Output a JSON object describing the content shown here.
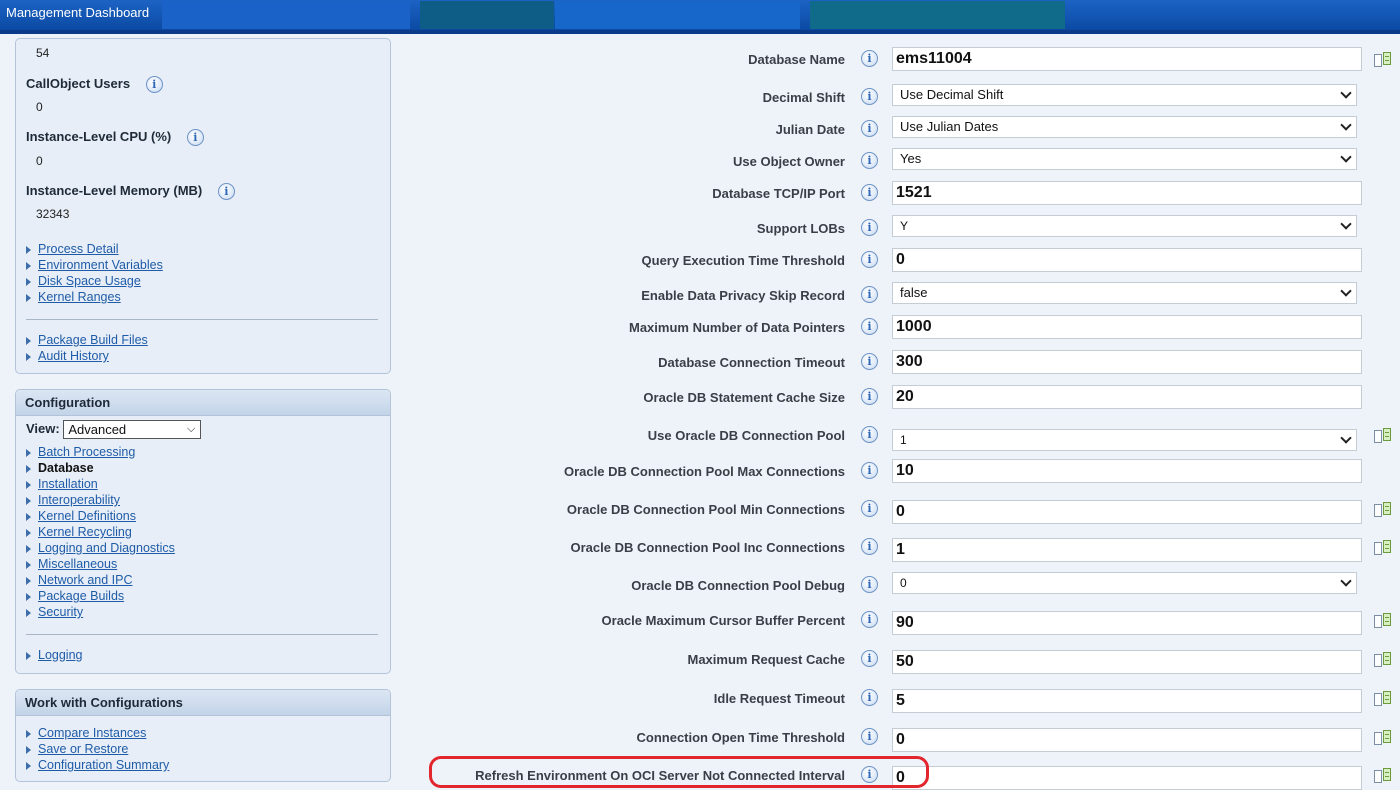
{
  "app": {
    "title": "Management Dashboard"
  },
  "sidebar": {
    "stats": [
      {
        "label": "",
        "value": "54"
      },
      {
        "label": "CallObject Users",
        "value": "0"
      },
      {
        "label": "Instance-Level CPU (%)",
        "value": "0"
      },
      {
        "label": "Instance-Level Memory (MB)",
        "value": "32343"
      }
    ],
    "links_group1": [
      "Process Detail",
      "Environment Variables",
      "Disk Space Usage",
      "Kernel Ranges"
    ],
    "links_group2": [
      "Package Build Files",
      "Audit History"
    ],
    "configuration": {
      "header": "Configuration",
      "view_label": "View:",
      "view_value": "Advanced",
      "items": [
        "Batch Processing",
        "Database",
        "Installation",
        "Interoperability",
        "Kernel Definitions",
        "Kernel Recycling",
        "Logging and Diagnostics",
        "Miscellaneous",
        "Network and IPC",
        "Package Builds",
        "Security"
      ],
      "active_item": "Database",
      "extra_items": [
        "Logging"
      ]
    },
    "work_with_configurations": {
      "header": "Work with Configurations",
      "items": [
        "Compare Instances",
        "Save or Restore",
        "Configuration Summary"
      ]
    }
  },
  "form": {
    "rows": [
      {
        "label": "Database Name",
        "type": "text",
        "value": "ems11004",
        "copy": true
      },
      {
        "label": "Decimal Shift",
        "type": "select",
        "value": "Use Decimal Shift",
        "copy": false
      },
      {
        "label": "Julian Date",
        "type": "select",
        "value": "Use Julian Dates",
        "copy": false
      },
      {
        "label": "Use Object Owner",
        "type": "select",
        "value": "Yes",
        "copy": false
      },
      {
        "label": "Database TCP/IP Port",
        "type": "text",
        "value": "1521",
        "copy": false
      },
      {
        "label": "Support LOBs",
        "type": "select",
        "value": "Y",
        "copy": false
      },
      {
        "label": "Query Execution Time Threshold",
        "type": "text",
        "value": "0",
        "copy": false
      },
      {
        "label": "Enable Data Privacy Skip Record",
        "type": "select",
        "value": "false",
        "copy": false
      },
      {
        "label": "Maximum Number of Data Pointers",
        "type": "text",
        "value": "1000",
        "copy": false
      },
      {
        "label": "Database Connection Timeout",
        "type": "text",
        "value": "300",
        "copy": false
      },
      {
        "label": "Oracle DB Statement Cache Size",
        "type": "text",
        "value": "20",
        "copy": false
      },
      {
        "label": "Use Oracle DB Connection Pool",
        "type": "select",
        "value": "1",
        "copy": true
      },
      {
        "label": "Oracle DB Connection Pool Max Connections",
        "type": "text",
        "value": "10",
        "copy": false
      },
      {
        "label": "Oracle DB Connection Pool Min Connections",
        "type": "text",
        "value": "0",
        "copy": true
      },
      {
        "label": "Oracle DB Connection Pool Inc Connections",
        "type": "text",
        "value": "1",
        "copy": true
      },
      {
        "label": "Oracle DB Connection Pool Debug",
        "type": "select",
        "value": "0",
        "copy": false
      },
      {
        "label": "Oracle Maximum Cursor Buffer Percent",
        "type": "text",
        "value": "90",
        "copy": true
      },
      {
        "label": "Maximum Request Cache",
        "type": "text",
        "value": "50",
        "copy": true
      },
      {
        "label": "Idle Request Timeout",
        "type": "text",
        "value": "5",
        "copy": true
      },
      {
        "label": "Connection Open Time Threshold",
        "type": "text",
        "value": "0",
        "copy": true
      },
      {
        "label": "Refresh Environment On OCI Server Not Connected Interval",
        "type": "text",
        "value": "0",
        "copy": true
      }
    ]
  },
  "colors": {
    "highlight": "#e1262d",
    "titlebar": "#0b4aa3",
    "link": "#1f5ca8"
  }
}
